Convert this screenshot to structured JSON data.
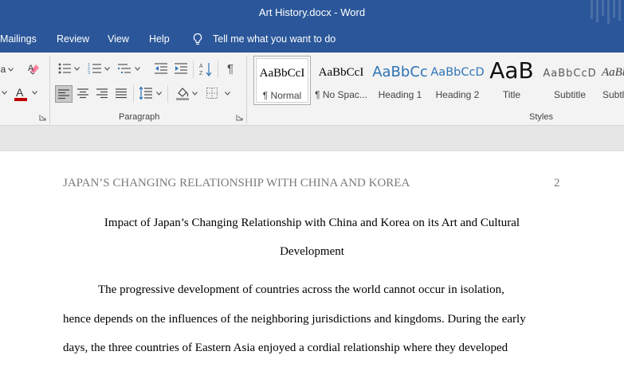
{
  "window": {
    "title": "Art History.docx  -  Word"
  },
  "tabs": {
    "mailings": "Mailings",
    "review": "Review",
    "view": "View",
    "help": "Help",
    "tell_me": "Tell me what you want to do"
  },
  "ribbon": {
    "paragraph_label": "Paragraph",
    "styles_label": "Styles",
    "styles": [
      {
        "preview": "AaBbCcI",
        "name": "¶ Normal"
      },
      {
        "preview": "AaBbCcI",
        "name": "¶ No Spac..."
      },
      {
        "preview": "AaBbCc",
        "name": "Heading 1"
      },
      {
        "preview": "AaBbCcD",
        "name": "Heading 2"
      },
      {
        "preview": "AaB",
        "name": "Title"
      },
      {
        "preview": "AaBbCcD",
        "name": "Subtitle"
      },
      {
        "preview": "AaBb",
        "name": "Subtl"
      }
    ]
  },
  "colors": {
    "title_bar": "#2b579a",
    "ribbon_bg": "#f3f3f3",
    "heading_blue": "#2e74b5",
    "font_color_red": "#c00000",
    "highlight_pink": "#ff7fa0"
  },
  "document": {
    "header_text": "JAPAN’S CHANGING RELATIONSHIP WITH CHINA AND KOREA",
    "page_number": "2",
    "heading_line1": "Impact of Japan’s Changing Relationship with China and Korea on its Art and Cultural",
    "heading_line2": "Development",
    "body_line1": "The progressive development of countries across the world cannot occur in isolation,",
    "body_line2": "hence depends on the influences of the neighboring jurisdictions and kingdoms. During the early",
    "body_line3": "days, the three countries of Eastern Asia enjoyed a cordial relationship where they developed"
  }
}
